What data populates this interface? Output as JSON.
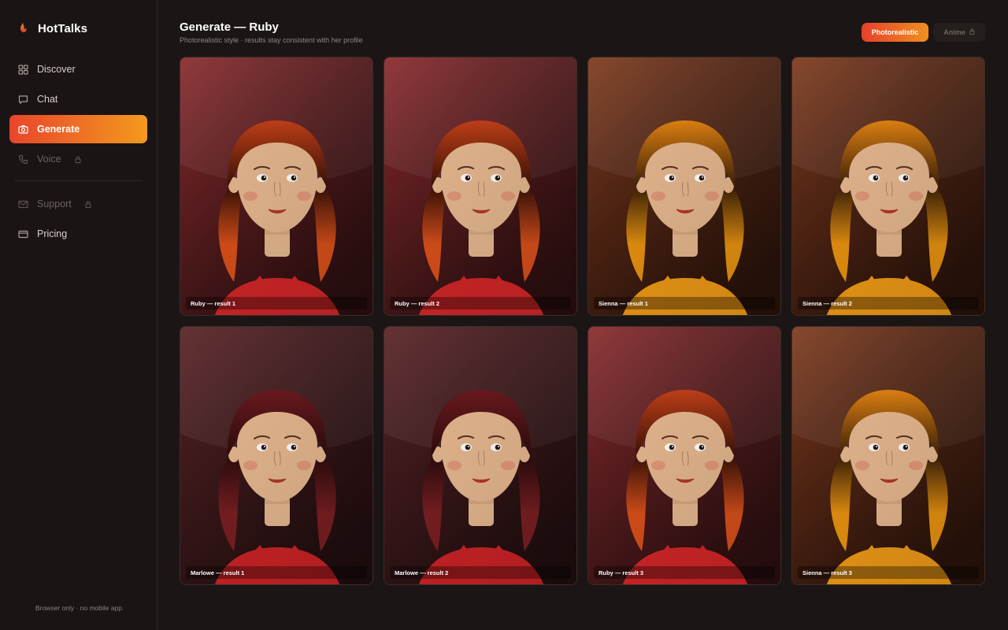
{
  "brand": {
    "name": "HotTalks",
    "icon": "flame-icon"
  },
  "nav": {
    "primary": [
      {
        "id": "discover",
        "label": "Discover",
        "icon": "grid-icon",
        "active": false,
        "locked": false
      },
      {
        "id": "chat",
        "label": "Chat",
        "icon": "chat-bubble-icon",
        "active": false,
        "locked": false
      },
      {
        "id": "generate",
        "label": "Generate",
        "icon": "camera-icon",
        "active": true,
        "locked": false
      },
      {
        "id": "voice",
        "label": "Voice",
        "icon": "phone-icon",
        "active": false,
        "locked": true
      }
    ],
    "secondary": [
      {
        "id": "support",
        "label": "Support",
        "icon": "mail-icon",
        "active": false,
        "locked": true
      },
      {
        "id": "pricing",
        "label": "Pricing",
        "icon": "card-icon",
        "active": false,
        "locked": false
      }
    ]
  },
  "footer": {
    "note": "Browser only · no mobile app"
  },
  "header": {
    "title": "Generate — Ruby",
    "subtitle": "Photorealistic style · results stay consistent with her profile"
  },
  "style_toggle": {
    "photorealistic": "Photorealistic",
    "anime": "Anime",
    "selected": "photorealistic"
  },
  "results": [
    {
      "caption": "Ruby — result 1",
      "theme": "ruby"
    },
    {
      "caption": "Ruby — result 2",
      "theme": "ruby"
    },
    {
      "caption": "Sienna — result 1",
      "theme": "sienna"
    },
    {
      "caption": "Sienna — result 2",
      "theme": "sienna"
    },
    {
      "caption": "Marlowe — result 1",
      "theme": "marlowe"
    },
    {
      "caption": "Marlowe — result 2",
      "theme": "marlowe"
    },
    {
      "caption": "Ruby — result 3",
      "theme": "ruby"
    },
    {
      "caption": "Sienna — result 3",
      "theme": "sienna"
    }
  ],
  "themes": {
    "ruby": {
      "bgTop": "#8a2a2d",
      "bgBottom": "#3e1517",
      "hairTop": "#c74118",
      "hairBottom": "#3b1208",
      "hairSide": "#d9501a",
      "shirt": "#d32628"
    },
    "sienna": {
      "bgTop": "#7e3a1e",
      "bgBottom": "#3a1a0e",
      "hairTop": "#e68512",
      "hairBottom": "#3d2108",
      "hairSide": "#e8920f",
      "shirt": "#ef9a16"
    },
    "marlowe": {
      "bgTop": "#5a2326",
      "bgBottom": "#2e1315",
      "hairTop": "#6e1a1f",
      "hairBottom": "#2c0c0d",
      "hairSide": "#7a1f22",
      "shirt": "#cc2326"
    }
  },
  "colors": {
    "accent_start": "#e9452b",
    "accent_end": "#f39a1d",
    "background": "#1b1615",
    "skin": "#e6b88f"
  }
}
